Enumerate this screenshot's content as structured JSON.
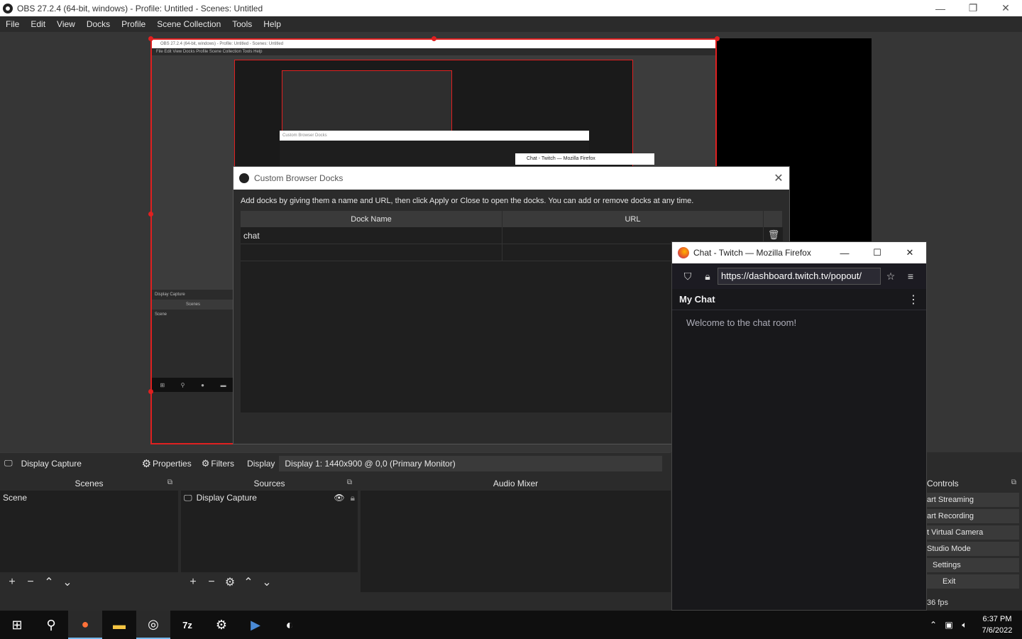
{
  "window": {
    "title": "OBS 27.2.4 (64-bit, windows) - Profile: Untitled - Scenes: Untitled"
  },
  "menu": [
    "File",
    "Edit",
    "View",
    "Docks",
    "Profile",
    "Scene Collection",
    "Tools",
    "Help"
  ],
  "nested": {
    "title": "OBS 27.2.4 (64-bit, windows) - Profile: Untitled - Scenes: Untitled",
    "menu": "File   Edit   View   Docks   Profile   Scene Collection   Tools   Help",
    "dialog_title": "Custom Browser Docks",
    "ff_title": "Chat - Twitch — Mozilla Firefox",
    "sidebar_source": "Display Capture",
    "sidebar_scenes": "Scenes",
    "sidebar_scene": "Scene"
  },
  "dialog": {
    "title": "Custom Browser Docks",
    "help": "Add docks by giving them a name and URL, then click Apply or Close to open the docks. You can add or remove docks at any time.",
    "col_name": "Dock Name",
    "col_url": "URL",
    "rows": [
      {
        "name": "chat",
        "url": ""
      }
    ]
  },
  "firefox": {
    "title": "Chat - Twitch — Mozilla Firefox",
    "url": "https://dashboard.twitch.tv/popout/",
    "chat_title": "My Chat",
    "welcome": "Welcome to the chat room!"
  },
  "source_bar": {
    "source": "Display Capture",
    "properties": "Properties",
    "filters": "Filters",
    "display_label": "Display",
    "display_value": "Display 1: 1440x900 @ 0,0 (Primary Monitor)"
  },
  "scenes": {
    "title": "Scenes",
    "items": [
      "Scene"
    ]
  },
  "sources": {
    "title": "Sources",
    "items": [
      "Display Capture"
    ]
  },
  "mixer": {
    "title": "Audio Mixer"
  },
  "controls": {
    "title": "Controls",
    "buttons": [
      "art Streaming",
      "art Recording",
      "t Virtual Camera",
      "Studio Mode",
      "Settings",
      "Exit"
    ]
  },
  "status": {
    "fps": "36 fps"
  },
  "clock": {
    "time": "6:37 PM",
    "date": "7/6/2022"
  }
}
